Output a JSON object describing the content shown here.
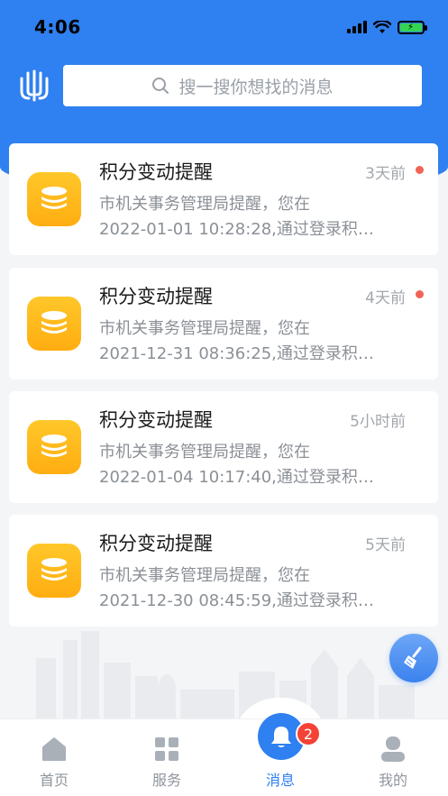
{
  "status_bar": {
    "time": "4:06"
  },
  "search": {
    "placeholder": "搜一搜你想找的消息"
  },
  "messages": [
    {
      "title": "积分变动提醒",
      "time": "3天前",
      "unread": true,
      "line1": "市机关事务管理局提醒，您在",
      "line2": "2022-01-01 10:28:28,通过登录积…"
    },
    {
      "title": "积分变动提醒",
      "time": "4天前",
      "unread": true,
      "line1": "市机关事务管理局提醒，您在",
      "line2": "2021-12-31 08:36:25,通过登录积…"
    },
    {
      "title": "积分变动提醒",
      "time": "5小时前",
      "unread": false,
      "line1": "市机关事务管理局提醒，您在",
      "line2": "2022-01-04 10:17:40,通过登录积…"
    },
    {
      "title": "积分变动提醒",
      "time": "5天前",
      "unread": false,
      "line1": "市机关事务管理局提醒，您在",
      "line2": "2021-12-30 08:45:59,通过登录积…"
    }
  ],
  "tabbar": {
    "tabs": [
      {
        "label": "首页",
        "icon": "home-icon"
      },
      {
        "label": "服务",
        "icon": "grid-icon"
      },
      {
        "label": "消息",
        "icon": "bell-icon",
        "active": true,
        "badge": "2"
      },
      {
        "label": "我的",
        "icon": "user-icon"
      }
    ]
  },
  "colors": {
    "primary": "#2f80f0",
    "unread_dot": "#f06455",
    "badge": "#f44336",
    "icon_yellow": "#ffb81c"
  }
}
